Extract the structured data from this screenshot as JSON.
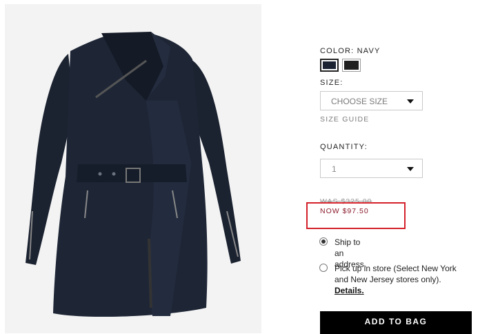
{
  "product_image": {
    "alt": "navy coat"
  },
  "color": {
    "label": "COLOR: NAVY",
    "swatches": [
      {
        "name": "navy",
        "hex": "#1b2333",
        "selected": true
      },
      {
        "name": "black",
        "hex": "#1f1f1f",
        "selected": false
      }
    ]
  },
  "size": {
    "label": "SIZE:",
    "selected_value": "CHOOSE SIZE",
    "guide_link": "SIZE GUIDE"
  },
  "quantity": {
    "label": "QUANTITY:",
    "selected_value": "1"
  },
  "price": {
    "was": "WAS $325.00",
    "now": "NOW $97.50"
  },
  "delivery": {
    "ship_option": "Ship to an address.",
    "pickup_option": "Pick up in store (Select New York and New Jersey stores only).",
    "details_link": "Details.",
    "selected": "ship"
  },
  "actions": {
    "add_to_bag": "ADD TO BAG"
  },
  "colors": {
    "accent": "#000000",
    "highlight": "#d4202a",
    "sale_price": "#8b1a2b"
  }
}
